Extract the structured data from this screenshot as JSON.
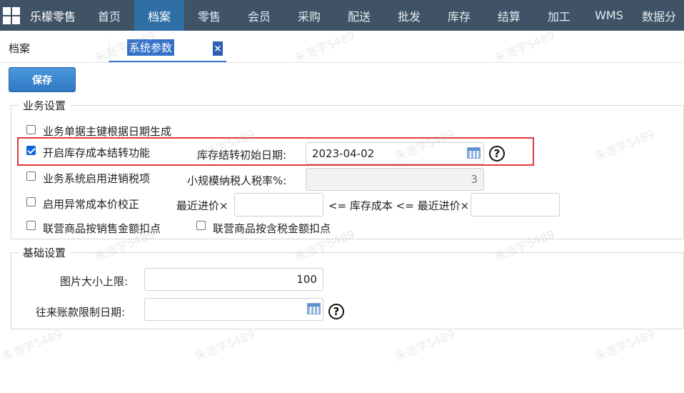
{
  "topbar": {
    "brand": "乐檬零售",
    "nav": [
      "首页",
      "档案",
      "零售",
      "会员",
      "采购",
      "配送",
      "批发",
      "库存",
      "结算",
      "加工",
      "WMS",
      "数据分"
    ],
    "active_index": 1
  },
  "tabs": {
    "home": "档案",
    "active": "系统参数",
    "close": "×"
  },
  "toolbar": {
    "save_label": "保存"
  },
  "business": {
    "legend": "业务设置",
    "opt_date_key": {
      "label": "业务单据主键根据日期生成",
      "checked": false
    },
    "opt_cost_carry": {
      "label": "开启库存成本结转功能",
      "checked": true
    },
    "carry_date_label": "库存结转初始日期:",
    "carry_date_value": "2023-04-02",
    "opt_tax": {
      "label": "业务系统启用进销税项",
      "checked": false
    },
    "small_tax_label": "小规模纳税人税率%:",
    "small_tax_value": "3",
    "opt_abnormal": {
      "label": "启用异常成本价校正",
      "checked": false
    },
    "recent_price_label": "最近进价×",
    "between_label": "<= 库存成本 <= 最近进价×",
    "opt_sales_deduct": {
      "label": "联营商品按销售金额扣点",
      "checked": false
    },
    "opt_tax_deduct": {
      "label": "联营商品按含税金额扣点",
      "checked": false
    }
  },
  "basic": {
    "legend": "基础设置",
    "image_limit_label": "图片大小上限:",
    "image_limit_value": "100",
    "payment_date_label": "往来账款限制日期:",
    "payment_date_value": ""
  },
  "watermark": "朱浩宇5489",
  "help_glyph": "?",
  "icons": {
    "apps": "apps-grid-icon",
    "calendar": "calendar-icon",
    "help": "help-icon",
    "close": "close-icon"
  },
  "colors": {
    "topbar": "#3f5266",
    "active_nav": "#2f6fa6",
    "save_button": "#3a86cf",
    "highlight": "#e03a3a"
  }
}
